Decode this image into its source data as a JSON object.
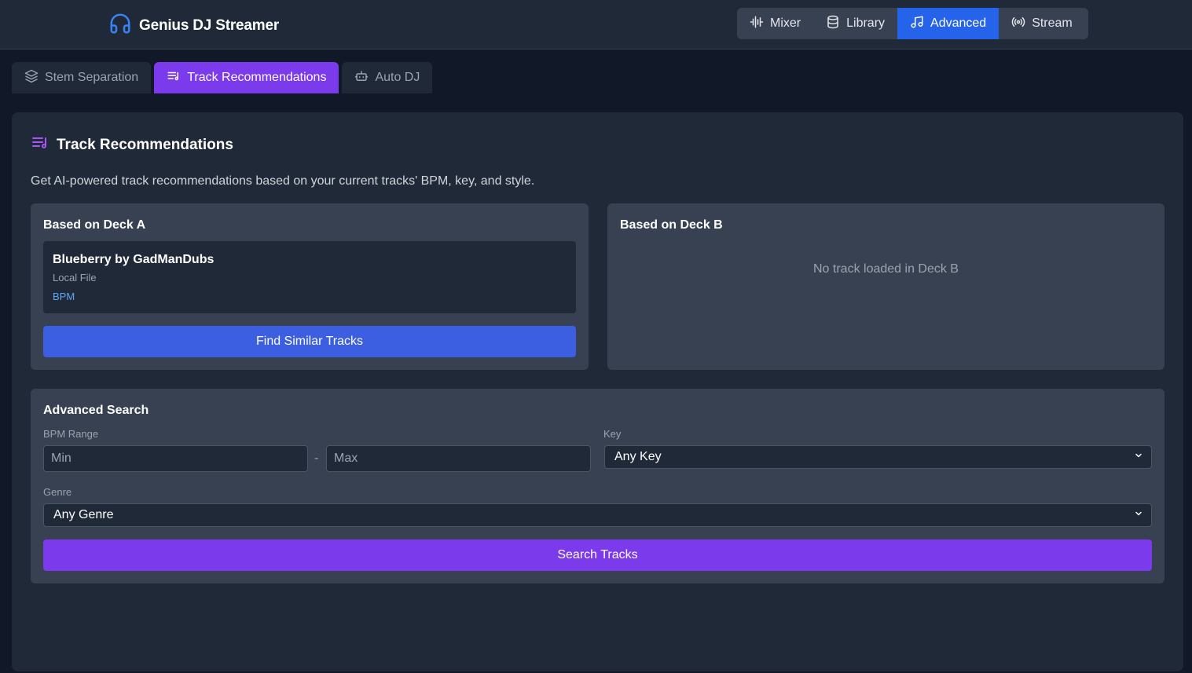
{
  "app": {
    "title": "Genius DJ Streamer",
    "accent": "#2563eb",
    "purple": "#7c3aed"
  },
  "nav": {
    "items": [
      {
        "label": "Mixer",
        "icon": "waveform-icon",
        "active": false
      },
      {
        "label": "Library",
        "icon": "database-icon",
        "active": false
      },
      {
        "label": "Advanced",
        "icon": "music-note-icon",
        "active": true
      },
      {
        "label": "Stream",
        "icon": "broadcast-icon",
        "active": false
      }
    ]
  },
  "tabs": [
    {
      "label": "Stem Separation",
      "icon": "layers-icon",
      "active": false
    },
    {
      "label": "Track Recommendations",
      "icon": "playlist-icon",
      "active": true
    },
    {
      "label": "Auto DJ",
      "icon": "robot-icon",
      "active": false
    }
  ],
  "panel": {
    "title": "Track Recommendations",
    "description": "Get AI-powered track recommendations based on your current tracks' BPM, key, and style."
  },
  "deck_a": {
    "title": "Based on Deck A",
    "track_name": "Blueberry by GadManDubs",
    "track_source": "Local File",
    "track_bpm": "BPM",
    "button": "Find Similar Tracks"
  },
  "deck_b": {
    "title": "Based on Deck B",
    "empty": "No track loaded in Deck B"
  },
  "advanced": {
    "title": "Advanced Search",
    "bpm_label": "BPM Range",
    "min_placeholder": "Min",
    "max_placeholder": "Max",
    "dash": "-",
    "key_label": "Key",
    "key_value": "Any Key",
    "genre_label": "Genre",
    "genre_value": "Any Genre",
    "button": "Search Tracks"
  }
}
